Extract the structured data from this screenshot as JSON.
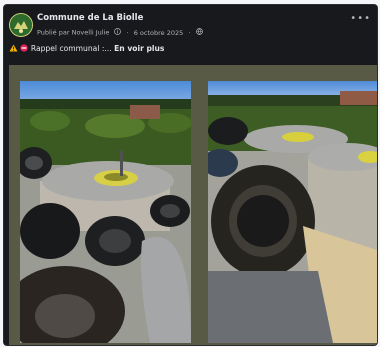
{
  "post": {
    "page_name": "Commune de La Biolle",
    "published_by": "Publié par Novelli Julie",
    "date": "6 octobre 2025",
    "separator": "·",
    "more_label": "•••",
    "warning_icon": "warning-icon",
    "no_entry_icon": "no-entry-icon",
    "message_text": " Rappel communal :...",
    "see_more": "En voir plus"
  },
  "colors": {
    "background": "#17191c",
    "photo_frame": "#595a46",
    "text": "#e4e6eb",
    "muted_text": "#b0b3b8"
  }
}
